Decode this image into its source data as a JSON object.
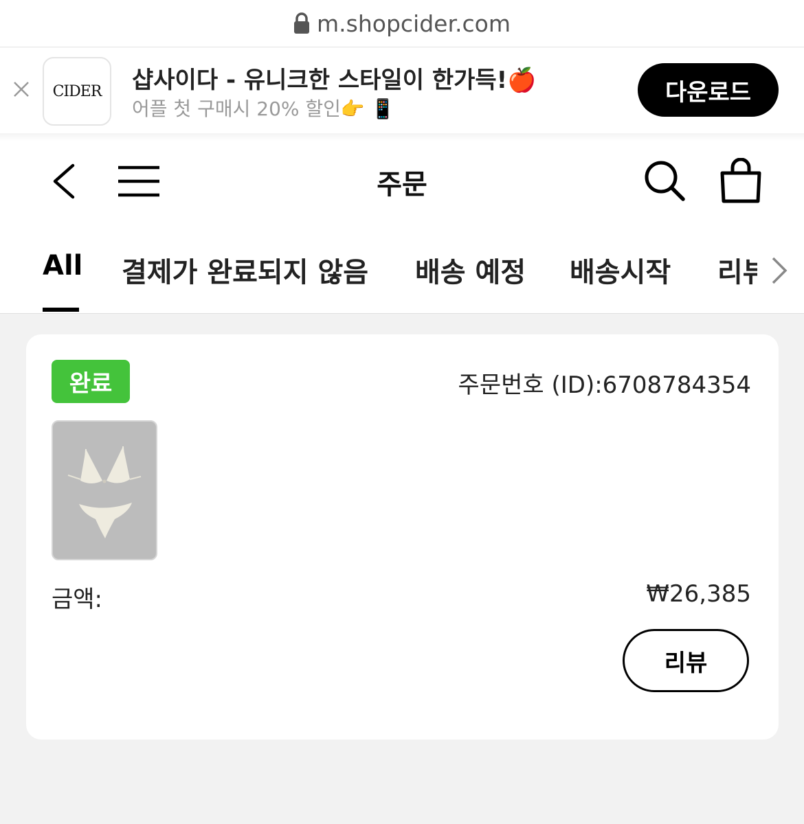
{
  "browser": {
    "url": "m.shopcider.com"
  },
  "app_banner": {
    "logo_text": "CIDER",
    "title": "샵사이다 - 유니크한 스타일이 한가득!🍎",
    "subtitle": "어플 첫 구매시 20% 할인👉 📱",
    "download_label": "다운로드"
  },
  "header": {
    "title": "주문"
  },
  "tabs": [
    {
      "label": "All",
      "active": true
    },
    {
      "label": "결제가 완료되지 않음"
    },
    {
      "label": "배송 예정"
    },
    {
      "label": "배송시작"
    },
    {
      "label": "리뷰"
    }
  ],
  "order": {
    "status": "완료",
    "order_number": "주문번호 (ID):6708784354",
    "amount_label": "금액:",
    "amount": "₩26,385",
    "review_label": "리뷰"
  },
  "colors": {
    "status_green": "#44c33b",
    "accent": "#000000",
    "page_bg": "#f2f2f2"
  }
}
